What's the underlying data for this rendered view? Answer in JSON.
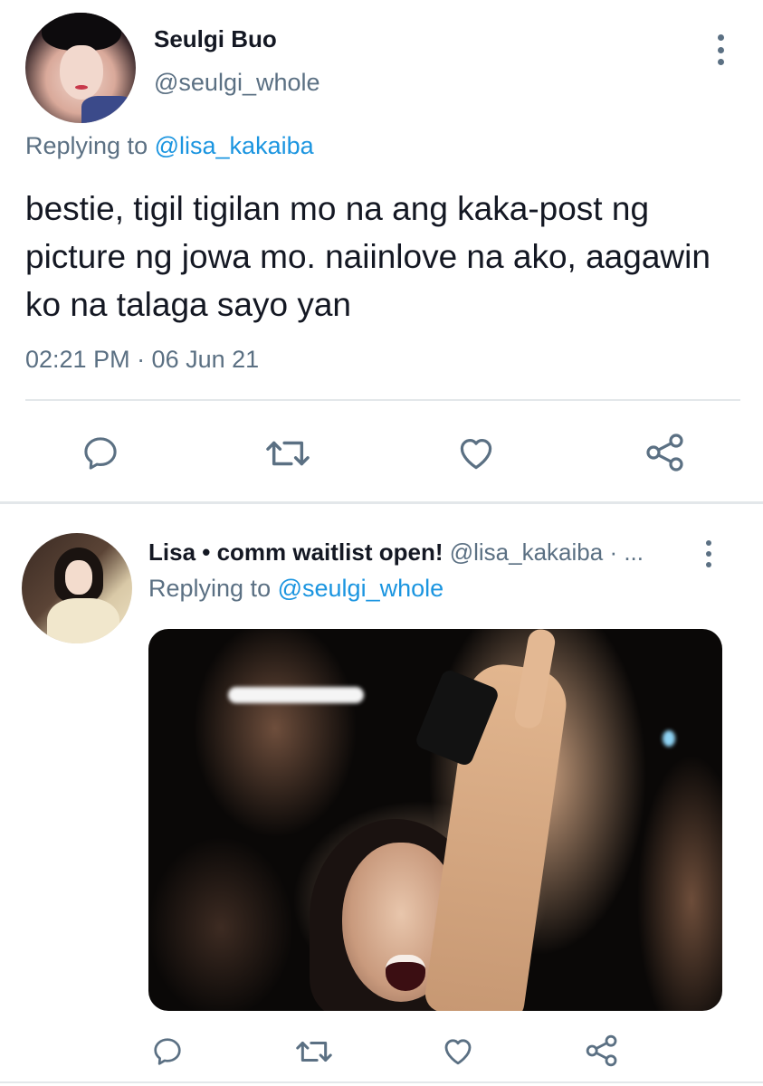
{
  "main_tweet": {
    "display_name": "Seulgi Buo",
    "handle": "@seulgi_whole",
    "replying_to_prefix": "Replying to",
    "replying_to_mention": "@lisa_kakaiba",
    "text": "bestie, tigil tigilan mo na ang kaka-post ng picture ng jowa mo. naiinlove na ako, aagawin ko na talaga sayo yan",
    "timestamp": "02:21 PM · 06 Jun 21",
    "actions": [
      "reply-icon",
      "retweet-icon",
      "like-icon",
      "share-icon"
    ]
  },
  "reply_tweet": {
    "display_name": "Lisa • comm waitlist open!",
    "handle": "@lisa_kakaiba · ...",
    "replying_to_prefix": "Replying to",
    "replying_to_mention": "@seulgi_whole",
    "media": "photo",
    "actions": [
      "reply-icon",
      "retweet-icon",
      "like-icon",
      "share-icon"
    ]
  },
  "colors": {
    "text_primary": "#141823",
    "text_secondary": "#5b7083",
    "mention": "#1b95e0",
    "divider": "#e3e7ea"
  }
}
